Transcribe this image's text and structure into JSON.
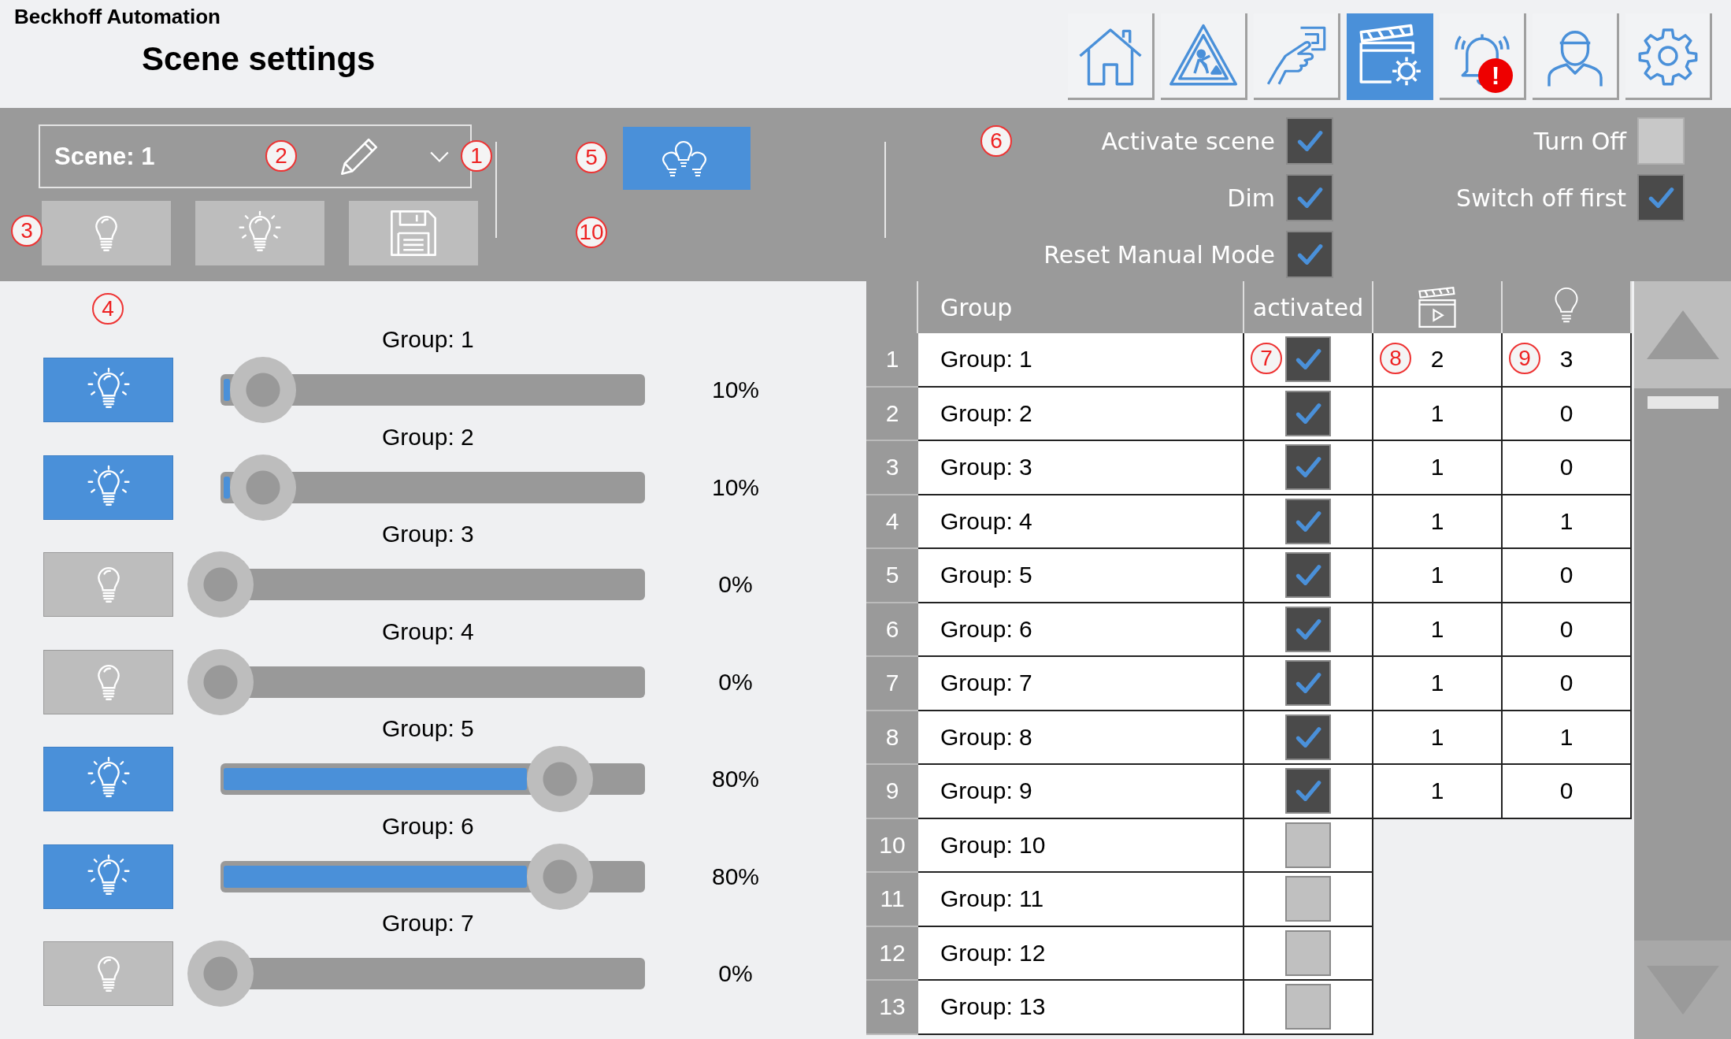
{
  "header": {
    "company": "Beckhoff Automation",
    "title": "Scene settings"
  },
  "nav": [
    {
      "kind": "home",
      "selected": false
    },
    {
      "kind": "warning",
      "selected": false
    },
    {
      "kind": "switch",
      "selected": false
    },
    {
      "kind": "scene",
      "selected": true
    },
    {
      "kind": "alarm",
      "selected": false,
      "alert_badge": "!"
    },
    {
      "kind": "user",
      "selected": false
    },
    {
      "kind": "settings",
      "selected": false
    }
  ],
  "scene_selector": {
    "value": "Scene: 1",
    "edit_note": "2",
    "dropdown_note": "1"
  },
  "tool_buttons": [
    {
      "kind": "lamp-off",
      "note": "3"
    },
    {
      "kind": "lamp-on"
    },
    {
      "kind": "save"
    }
  ],
  "all_groups_button": {
    "note": "5",
    "note_below": "10"
  },
  "options_note": "6",
  "options_left": [
    {
      "label": "Activate scene",
      "checked": true
    },
    {
      "label": "Dim",
      "checked": true
    },
    {
      "label": "Reset Manual Mode",
      "checked": true
    }
  ],
  "options_right": [
    {
      "label": "Turn Off",
      "checked": false
    },
    {
      "label": "Switch off first",
      "checked": true
    }
  ],
  "groups_note": "4",
  "groups": [
    {
      "label": "Group: 1",
      "on": true,
      "level": 0.1,
      "reading": "10%"
    },
    {
      "label": "Group: 2",
      "on": true,
      "level": 0.1,
      "reading": "10%"
    },
    {
      "label": "Group: 3",
      "on": false,
      "level": 0,
      "reading": "0%"
    },
    {
      "label": "Group: 4",
      "on": false,
      "level": 0,
      "reading": "0%"
    },
    {
      "label": "Group: 5",
      "on": true,
      "level": 0.8,
      "reading": "80%"
    },
    {
      "label": "Group: 6",
      "on": true,
      "level": 0.8,
      "reading": "80%"
    },
    {
      "label": "Group: 7",
      "on": false,
      "level": 0,
      "reading": "0%"
    }
  ],
  "table": {
    "columns": [
      "Group",
      "activated"
    ],
    "rows": [
      {
        "index": "1",
        "group": "Group: 1",
        "activated": true,
        "scene": "2",
        "lamp": "3",
        "activated_note": "7",
        "scene_note": "8",
        "lamp_note": "9"
      },
      {
        "index": "2",
        "group": "Group: 2",
        "activated": true,
        "scene": "1",
        "lamp": "0"
      },
      {
        "index": "3",
        "group": "Group: 3",
        "activated": true,
        "scene": "1",
        "lamp": "0"
      },
      {
        "index": "4",
        "group": "Group: 4",
        "activated": true,
        "scene": "1",
        "lamp": "1"
      },
      {
        "index": "5",
        "group": "Group: 5",
        "activated": true,
        "scene": "1",
        "lamp": "0"
      },
      {
        "index": "6",
        "group": "Group: 6",
        "activated": true,
        "scene": "1",
        "lamp": "0"
      },
      {
        "index": "7",
        "group": "Group: 7",
        "activated": true,
        "scene": "1",
        "lamp": "0"
      },
      {
        "index": "8",
        "group": "Group: 8",
        "activated": true,
        "scene": "1",
        "lamp": "1"
      },
      {
        "index": "9",
        "group": "Group: 9",
        "activated": true,
        "scene": "1",
        "lamp": "0"
      },
      {
        "index": "10",
        "group": "Group: 10",
        "activated": false
      },
      {
        "index": "11",
        "group": "Group: 11",
        "activated": false
      },
      {
        "index": "12",
        "group": "Group: 12",
        "activated": false
      },
      {
        "index": "13",
        "group": "Group: 13",
        "activated": false
      }
    ]
  }
}
